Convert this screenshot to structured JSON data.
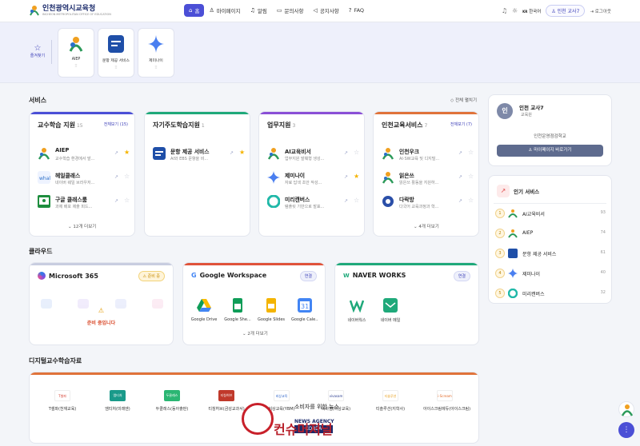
{
  "header": {
    "logo_title": "인천광역시교육청",
    "logo_sub": "INCHEON METROPOLITAN OFFICE OF EDUCATION",
    "nav": [
      {
        "label": "홈",
        "icon": "home-icon",
        "active": true
      },
      {
        "label": "마이페이지",
        "icon": "user-icon"
      },
      {
        "label": "알림",
        "icon": "bell-icon"
      },
      {
        "label": "문의사항",
        "icon": "chat-icon"
      },
      {
        "label": "공지사항",
        "icon": "megaphone-icon"
      },
      {
        "label": "FAQ",
        "icon": "question-icon"
      }
    ],
    "lang": "한국어",
    "user_pill": "인천 교사7",
    "logout": "로그아웃"
  },
  "favorites": {
    "label": "즐겨찾기",
    "items": [
      {
        "label": "AIEP"
      },
      {
        "label": "문항 제공 서비스"
      },
      {
        "label": "제미나이"
      }
    ]
  },
  "services": {
    "title": "서비스",
    "collapse_all": "전체 펼치기",
    "columns": [
      {
        "title": "교수학습 지원",
        "count": "15",
        "more": "전체보기 (15)",
        "accent": "#4b4fd6",
        "items": [
          {
            "name": "AIEP",
            "desc": "교수학습 환경에서 발...",
            "starred": true
          },
          {
            "name": "헤일클래스",
            "desc": "네이버 웨일 브라우저...",
            "starred": false
          },
          {
            "name": "구글 클래스룸",
            "desc": "과제 배포 제출 피드...",
            "starred": false
          }
        ],
        "footer": "12개 더보기"
      },
      {
        "title": "자기주도학습지원",
        "count": "1",
        "more": "",
        "accent": "#1fa97a",
        "items": [
          {
            "name": "문항 제공 서비스",
            "desc": "AI와 EBS 문항을 비...",
            "starred": true
          }
        ],
        "footer": ""
      },
      {
        "title": "업무지원",
        "count": "3",
        "more": "",
        "accent": "#8a4fd6",
        "items": [
          {
            "name": "AI교육비서",
            "desc": "업무지원 발췌형 생성...",
            "starred": false
          },
          {
            "name": "제미나이",
            "desc": "자료 답색 초안 작성...",
            "starred": true
          },
          {
            "name": "미리캔버스",
            "desc": "템플릿 기반으로 발표...",
            "starred": false
          }
        ],
        "footer": ""
      },
      {
        "title": "인천교육서비스",
        "count": "7",
        "more": "전체보기 (7)",
        "accent": "#e0733a",
        "items": [
          {
            "name": "인천우크",
            "desc": "AI·SW교육 및 디지털...",
            "starred": false
          },
          {
            "name": "읽은쓰",
            "desc": "읽은쓰 활동을 지원하...",
            "starred": false
          },
          {
            "name": "다락방",
            "desc": "다국어 교육과정과 학...",
            "starred": false
          }
        ],
        "footer": "4개 더보기"
      }
    ]
  },
  "profile": {
    "initial": "인",
    "name": "인천 교사7",
    "role": "교육원",
    "school": "인천운영점검학교",
    "button": "마이페이지 바로가기"
  },
  "popular": {
    "title": "인기 서비스",
    "items": [
      {
        "rank": "1",
        "name": "AI교육비서",
        "count": "93"
      },
      {
        "rank": "2",
        "name": "AIEP",
        "count": "74"
      },
      {
        "rank": "3",
        "name": "문항 제공 서비스",
        "count": "61"
      },
      {
        "rank": "4",
        "name": "제미나이",
        "count": "40"
      },
      {
        "rank": "5",
        "name": "미리캔버스",
        "count": "32"
      }
    ]
  },
  "cloud": {
    "title": "클라우드",
    "cards": [
      {
        "title": "Microsoft 365",
        "badge": "준비 중",
        "note": "준비 중입니다",
        "accent": "#9aa3c8"
      },
      {
        "title": "Google Workspace",
        "badge": "연결",
        "accent": "#e0533a",
        "apps": [
          "Google Drive",
          "Google She...",
          "Google Slides",
          "Google Cale..."
        ],
        "footer": "2개 더보기"
      },
      {
        "title": "NAVER WORKS",
        "badge": "연결",
        "accent": "#1fa97a",
        "apps": [
          "네이버웍스",
          "네이버 메일"
        ]
      }
    ]
  },
  "digital": {
    "title": "디지털교수학습자료",
    "items": [
      {
        "label": "T셀파(천재교육)",
        "tag": "T셀파",
        "color": "#d33a2c"
      },
      {
        "label": "엠티처(미래엔)",
        "tag": "엠티처",
        "color": "#1a9a8a"
      },
      {
        "label": "두클래스(동아출판)",
        "tag": "두클래스",
        "color": "#2bb673"
      },
      {
        "label": "티칭허브(금성교과서)",
        "tag": "티칭허브",
        "color": "#c0392b"
      },
      {
        "label": "비상교육(YBM)",
        "tag": "비상교육",
        "color": "#2e64c8"
      },
      {
        "label": "비바샘(비상교육)",
        "tag": "vivasam",
        "color": "#2a3b8f"
      },
      {
        "label": "티솔루션(지학사)",
        "tag": "티솔루션",
        "color": "#e8a020"
      },
      {
        "label": "아이스크림에듀(아이스크림)",
        "tag": "i-Scream",
        "color": "#e36b2a"
      }
    ]
  },
  "watermark": {
    "line1": "소비자를 위한 뉴스",
    "line2": "NEWS AGENCY",
    "line3": "KOREA",
    "brand": "컨슈머저널"
  }
}
